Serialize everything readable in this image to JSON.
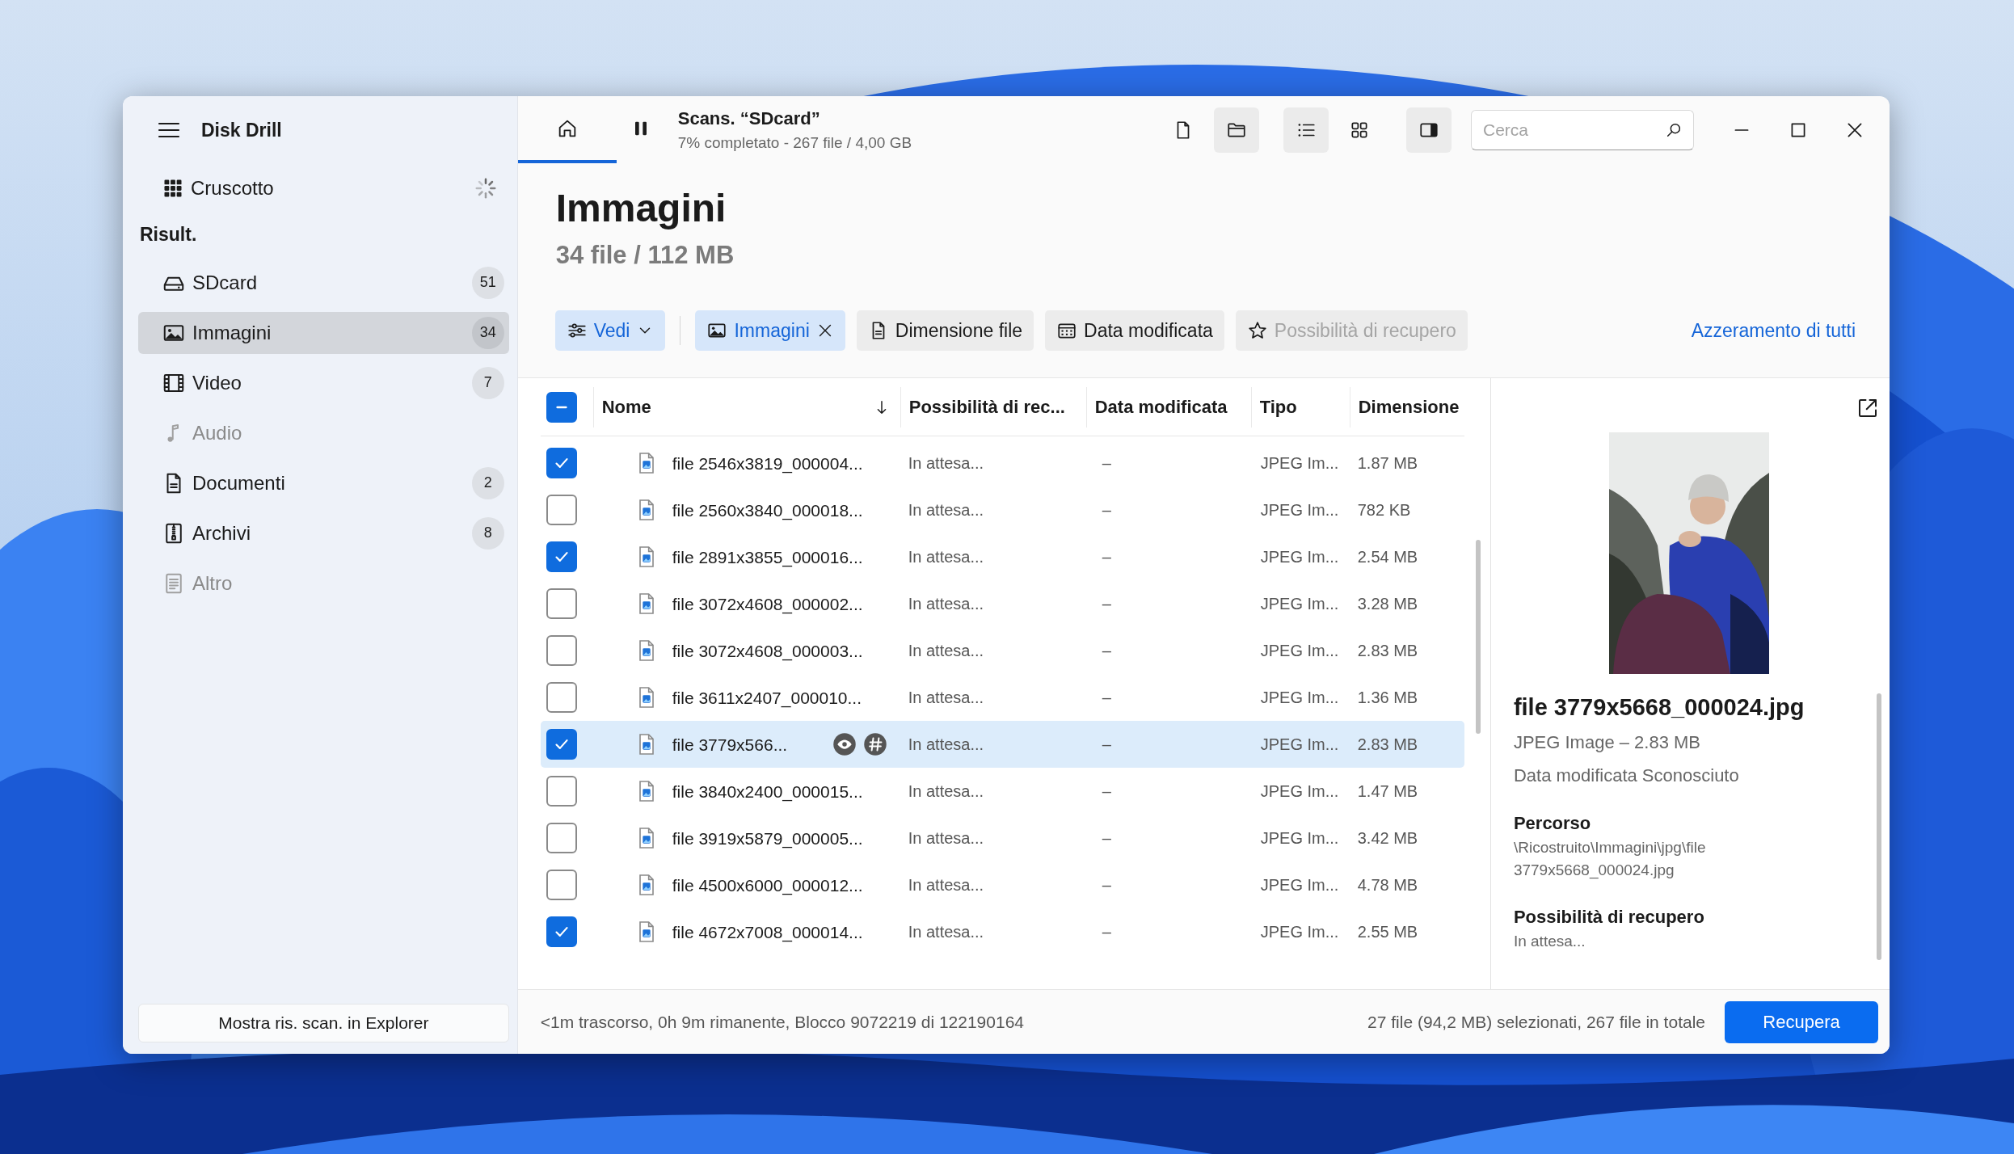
{
  "app": {
    "title": "Disk Drill"
  },
  "sidebar": {
    "dashboard": {
      "label": "Cruscotto",
      "busy": true
    },
    "section": "Risult.",
    "items": [
      {
        "label": "SDcard",
        "count": "51",
        "selected": false,
        "disabled": false
      },
      {
        "label": "Immagini",
        "count": "34",
        "selected": true,
        "disabled": false
      },
      {
        "label": "Video",
        "count": "7",
        "selected": false,
        "disabled": false
      },
      {
        "label": "Audio",
        "selected": false,
        "disabled": true
      },
      {
        "label": "Documenti",
        "count": "2",
        "selected": false,
        "disabled": false
      },
      {
        "label": "Archivi",
        "count": "8",
        "selected": false,
        "disabled": false
      },
      {
        "label": "Altro",
        "selected": false,
        "disabled": true
      }
    ],
    "footer_button": "Mostra ris. scan. in Explorer"
  },
  "toolbar": {
    "tabs": [
      {
        "selected": true
      },
      {
        "selected": false
      }
    ],
    "scan_title": "Scans. “SDcard”",
    "scan_status": "7% completato - 267 file / 4,00 GB",
    "view_buttons": [
      {
        "selected": false
      },
      {
        "selected": true
      },
      {
        "selected": true
      },
      {
        "selected": false
      },
      {
        "selected": true
      }
    ],
    "search": {
      "placeholder": "Cerca"
    }
  },
  "header": {
    "title": "Immagini",
    "subtitle": "34 file / 112 MB"
  },
  "filters": [
    {
      "label": "Vedi",
      "kind": "dropdown",
      "active": true,
      "disabled": false
    },
    {
      "label": "Immagini",
      "kind": "chip",
      "active": true,
      "disabled": false
    },
    {
      "label": "Dimensione file",
      "kind": "filter",
      "active": false,
      "disabled": false
    },
    {
      "label": "Data modificata",
      "kind": "filter",
      "active": false,
      "disabled": false
    },
    {
      "label": "Possibilità di recupero",
      "kind": "filter",
      "active": false,
      "disabled": true
    }
  ],
  "reset_link": "Azzeramento di tutti",
  "table": {
    "select_all": {
      "indeterminate": true
    },
    "columns": [
      {
        "label": "Nome",
        "sorted": true
      },
      {
        "label": "Possibilità di rec...",
        "sorted": false
      },
      {
        "label": "Data modificata",
        "sorted": false
      },
      {
        "label": "Tipo",
        "sorted": false
      },
      {
        "label": "Dimensione",
        "sorted": false
      }
    ],
    "rows": [
      {
        "name": "file 2546x3819_000004...",
        "recovery": "In attesa...",
        "date": "–",
        "type": "JPEG Im...",
        "size": "1.87 MB",
        "checked": true,
        "selected": false
      },
      {
        "name": "file 2560x3840_000018...",
        "recovery": "In attesa...",
        "date": "–",
        "type": "JPEG Im...",
        "size": "782 KB",
        "checked": false,
        "selected": false
      },
      {
        "name": "file 2891x3855_000016...",
        "recovery": "In attesa...",
        "date": "–",
        "type": "JPEG Im...",
        "size": "2.54 MB",
        "checked": true,
        "selected": false
      },
      {
        "name": "file 3072x4608_000002...",
        "recovery": "In attesa...",
        "date": "–",
        "type": "JPEG Im...",
        "size": "3.28 MB",
        "checked": false,
        "selected": false
      },
      {
        "name": "file 3072x4608_000003...",
        "recovery": "In attesa...",
        "date": "–",
        "type": "JPEG Im...",
        "size": "2.83 MB",
        "checked": false,
        "selected": false
      },
      {
        "name": "file 3611x2407_000010...",
        "recovery": "In attesa...",
        "date": "–",
        "type": "JPEG Im...",
        "size": "1.36 MB",
        "checked": false,
        "selected": false
      },
      {
        "name": "file 3779x566...",
        "recovery": "In attesa...",
        "date": "–",
        "type": "JPEG Im...",
        "size": "2.83 MB",
        "checked": true,
        "selected": true
      },
      {
        "name": "file 3840x2400_000015...",
        "recovery": "In attesa...",
        "date": "–",
        "type": "JPEG Im...",
        "size": "1.47 MB",
        "checked": false,
        "selected": false
      },
      {
        "name": "file 3919x5879_000005...",
        "recovery": "In attesa...",
        "date": "–",
        "type": "JPEG Im...",
        "size": "3.42 MB",
        "checked": false,
        "selected": false
      },
      {
        "name": "file 4500x6000_000012...",
        "recovery": "In attesa...",
        "date": "–",
        "type": "JPEG Im...",
        "size": "4.78 MB",
        "checked": false,
        "selected": false
      },
      {
        "name": "file 4672x7008_000014...",
        "recovery": "In attesa...",
        "date": "–",
        "type": "JPEG Im...",
        "size": "2.55 MB",
        "checked": true,
        "selected": false
      }
    ]
  },
  "preview": {
    "filename": "file 3779x5668_000024.jpg",
    "type_size": "JPEG Image – 2.83 MB",
    "modified": "Data modificata Sconosciuto",
    "fields": [
      {
        "label": "Percorso",
        "value": "\\Ricostruito\\Immagini\\jpg\\file 3779x5668_000024.jpg"
      },
      {
        "label": "Possibilità di recupero",
        "value": "In attesa..."
      }
    ]
  },
  "status_bar": {
    "progress": "<1m trascorso, 0h 9m rimanente, Blocco 9072219 di 122190164",
    "selection": "27 file (94,2 MB) selezionati, 267 file in totale",
    "recover_button": "Recupera"
  }
}
